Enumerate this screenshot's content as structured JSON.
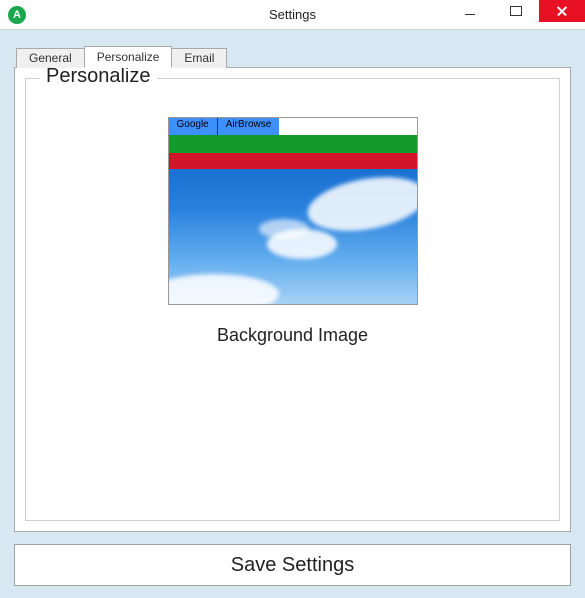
{
  "window": {
    "title": "Settings",
    "app_icon_letter": "A"
  },
  "tabs": {
    "general": "General",
    "personalize": "Personalize",
    "email": "Email"
  },
  "panel": {
    "group_title": "Personalize",
    "preview_tabs": {
      "t1": "Google",
      "t2": "AirBrowse"
    },
    "caption": "Background Image"
  },
  "buttons": {
    "save": "Save Settings"
  }
}
